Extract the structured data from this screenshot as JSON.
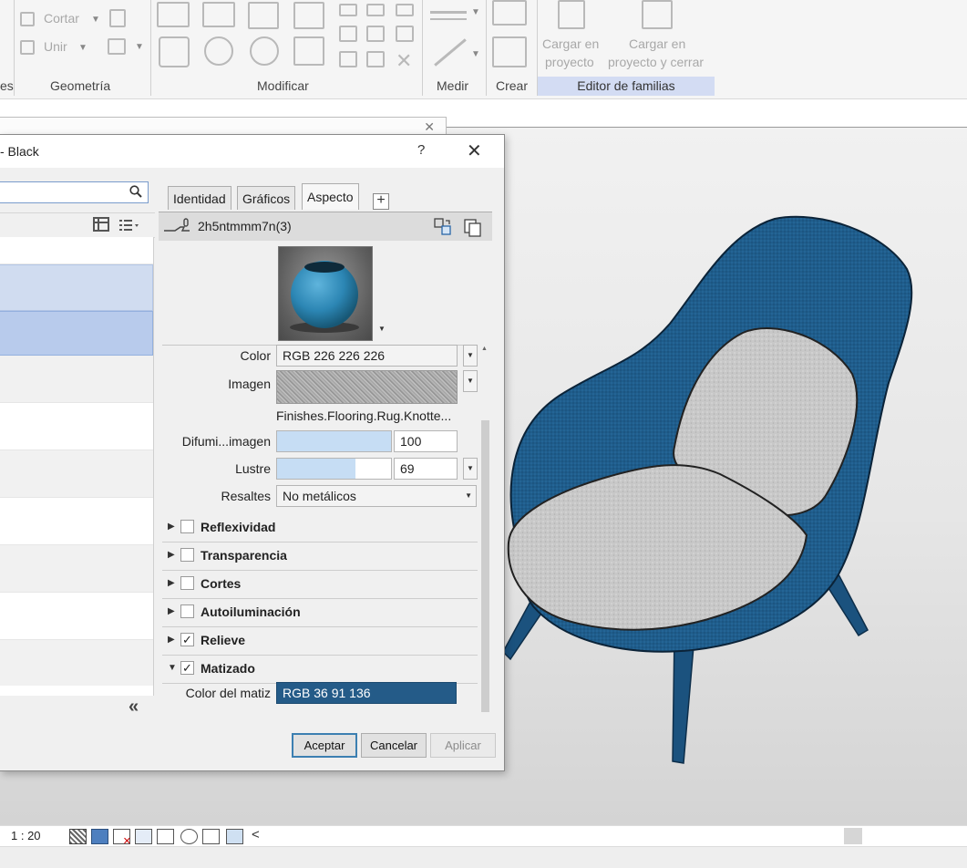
{
  "ribbon": {
    "panels": {
      "geometry_partial": "es",
      "geometry": "Geometría",
      "modify": "Modificar",
      "measure": "Medir",
      "create": "Crear",
      "family_editor": "Editor de familias"
    },
    "cut_label": "Cortar",
    "join_label": "Unir",
    "load_project_line1": "Cargar en",
    "load_project_line2": "proyecto",
    "load_close_line1": "Cargar en",
    "load_close_line2": "proyecto y cerrar"
  },
  "dialog": {
    "title": "- Black",
    "help": "?",
    "close": "✕",
    "tabs": [
      "Identidad",
      "Gráficos",
      "Aspecto"
    ],
    "add_tab": "+",
    "asset_name": "2h5ntmmm7n(3)",
    "properties": {
      "color_label": "Color",
      "color_value": "RGB 226 226 226",
      "image_label": "Imagen",
      "image_name": "Finishes.Flooring.Rug.Knotte...",
      "fade_label": "Difumi...imagen",
      "fade_value": "100",
      "fade_fraction": 1.0,
      "gloss_label": "Lustre",
      "gloss_value": "69",
      "gloss_fraction": 0.69,
      "highlights_label": "Resaltes",
      "highlights_value": "No metálicos"
    },
    "sections": [
      {
        "label": "Reflexividad",
        "checked": false,
        "expanded": false
      },
      {
        "label": "Transparencia",
        "checked": false,
        "expanded": false
      },
      {
        "label": "Cortes",
        "checked": false,
        "expanded": false
      },
      {
        "label": "Autoiluminación",
        "checked": false,
        "expanded": false
      },
      {
        "label": "Relieve",
        "checked": true,
        "expanded": false
      },
      {
        "label": "Matizado",
        "checked": true,
        "expanded": true
      }
    ],
    "tint_label": "Color del matiz",
    "tint_value": "RGB 36 91 136",
    "tint_color": "#245b88",
    "buttons": {
      "ok": "Aceptar",
      "cancel": "Cancelar",
      "apply": "Aplicar"
    },
    "collapse_icon": "«"
  },
  "statusbar": {
    "scale": "1 : 20",
    "chevron": "<"
  },
  "colors": {
    "chair_blue": "#1f5d8c",
    "cushion_gray": "#c9c9c9",
    "selection": "#b8cbec",
    "ribbon_active": "#d3dcf3"
  }
}
